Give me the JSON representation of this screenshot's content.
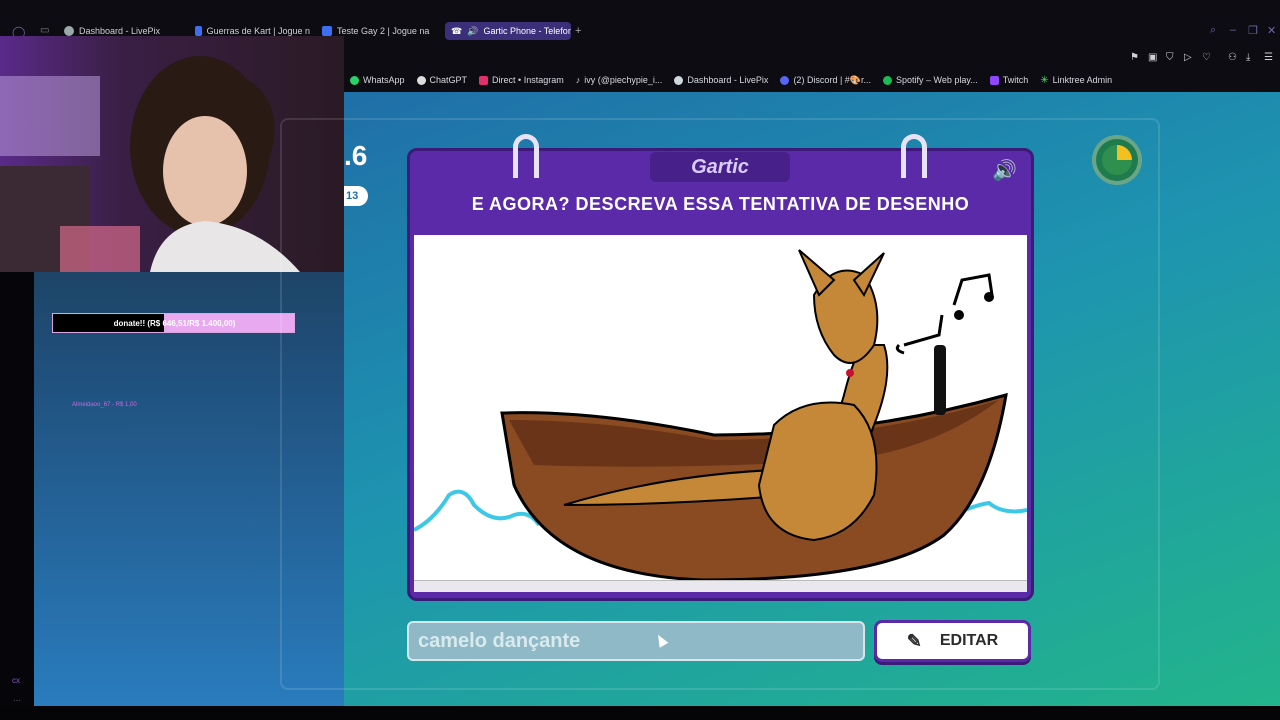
{
  "browser": {
    "tabs": [
      {
        "label": "Dashboard - LivePix"
      },
      {
        "label": "Guerras de Kart | Jogue n"
      },
      {
        "label": "Teste Gay 2 | Jogue na"
      },
      {
        "label": "Gartic Phone - Telefon",
        "active": true
      }
    ],
    "new_tab": "+",
    "bookmarks": [
      {
        "label": "WhatsApp",
        "color": "#25d366"
      },
      {
        "label": "ChatGPT",
        "color": "#ffffff"
      },
      {
        "label": "Direct • Instagram",
        "color": "#e1306c"
      },
      {
        "label": "ivy (@piechypie_i...",
        "color": "#ffffff"
      },
      {
        "label": "Dashboard - LivePix",
        "color": "#cfd8dc"
      },
      {
        "label": "(2) Discord | #🎨r...",
        "color": "#5865f2"
      },
      {
        "label": "Spotify – Web play...",
        "color": "#1db954"
      },
      {
        "label": "Twitch",
        "color": "#9146ff"
      },
      {
        "label": "Linktree Admin",
        "color": "#43e660"
      }
    ]
  },
  "stream_overlay": {
    "donate_label": "donate!! (R$ 646,51/R$ 1.400,00)",
    "donate_progress": 0.46,
    "last_donor": "Almeidaoo_67 - R$ 1,00"
  },
  "game": {
    "score": ".6",
    "player_count": "13",
    "logo": "Gartic",
    "prompt": "E AGORA? DESCREVA ESSA TENTATIVA DE DESENHO",
    "answer_value": "camelo dançante",
    "edit_label": "EDITAR",
    "colors": {
      "card": "#5a2aa8",
      "accent": "#f4c020"
    }
  }
}
